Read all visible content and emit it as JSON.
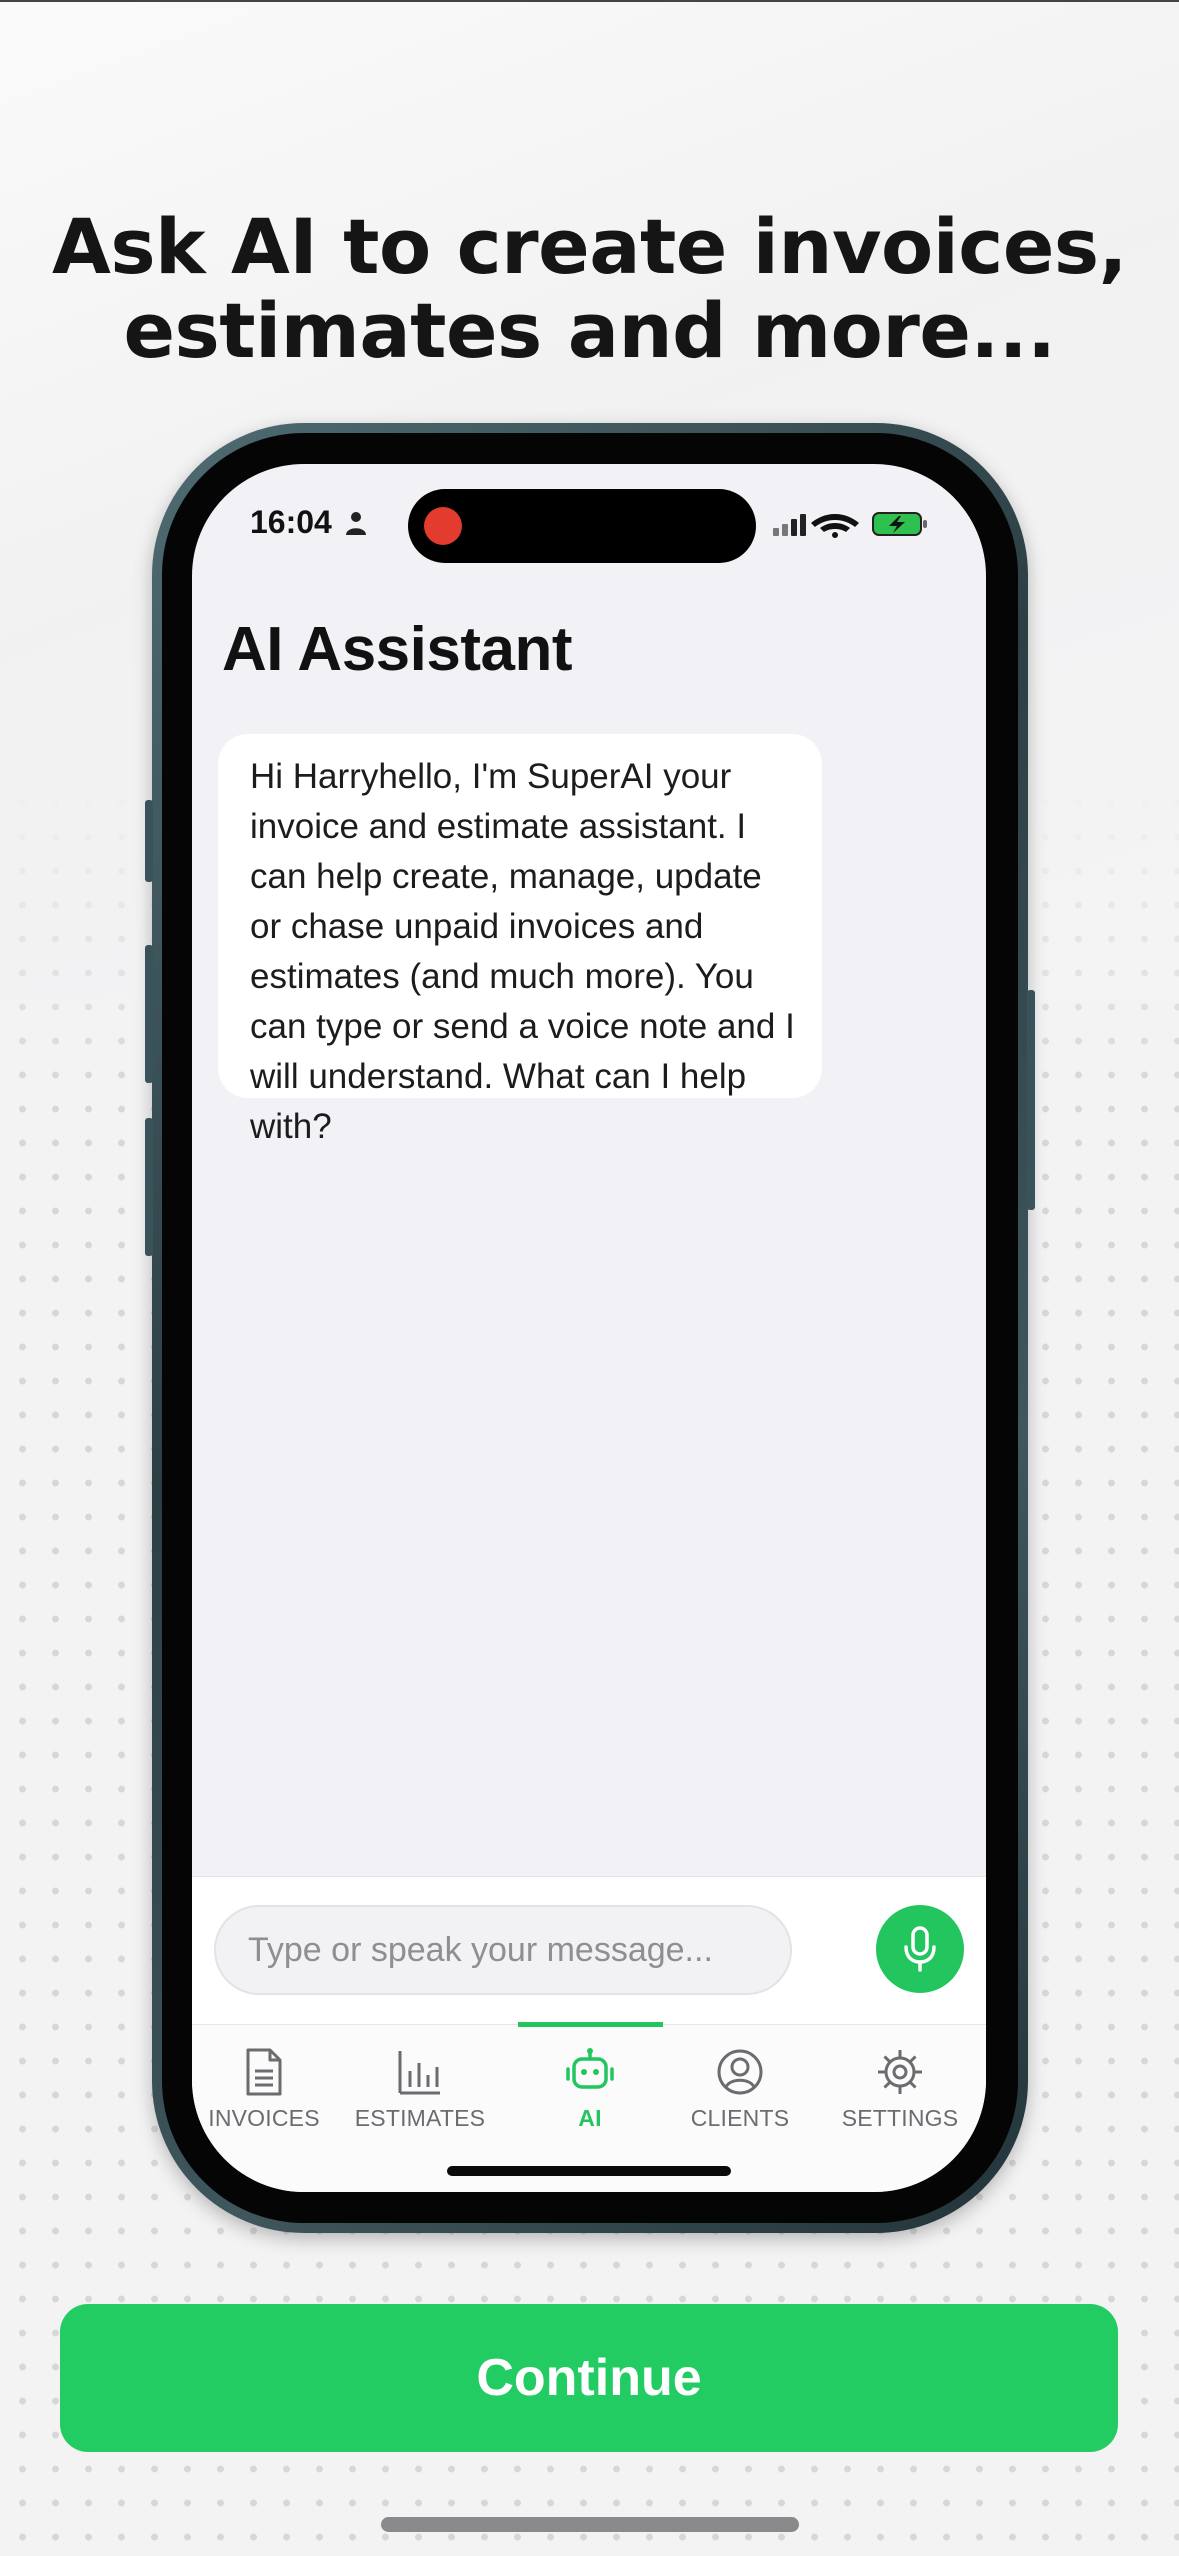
{
  "promo": {
    "headline_line1": "Ask AI to create invoices,",
    "headline_line2": "estimates and more..."
  },
  "status_bar": {
    "time": "16:04"
  },
  "screen": {
    "title": "AI Assistant",
    "assistant_message": "Hi Harryhello, I'm SuperAI your invoice and estimate assistant. I can help create, manage, update or chase unpaid invoices and estimates (and much more). You can type or send a voice note and I will understand. What can I help with?"
  },
  "composer": {
    "placeholder": "Type or speak your message..."
  },
  "tabbar": {
    "tabs": [
      {
        "label": "INVOICES",
        "icon": "document-icon"
      },
      {
        "label": "ESTIMATES",
        "icon": "bar-chart-icon"
      },
      {
        "label": "AI",
        "icon": "robot-icon",
        "active": true
      },
      {
        "label": "CLIENTS",
        "icon": "user-circle-icon"
      },
      {
        "label": "SETTINGS",
        "icon": "gear-icon"
      }
    ]
  },
  "cta": {
    "continue_label": "Continue"
  },
  "colors": {
    "accent": "#22c55e",
    "cta": "#22cc63",
    "record_dot": "#e33b2e"
  }
}
